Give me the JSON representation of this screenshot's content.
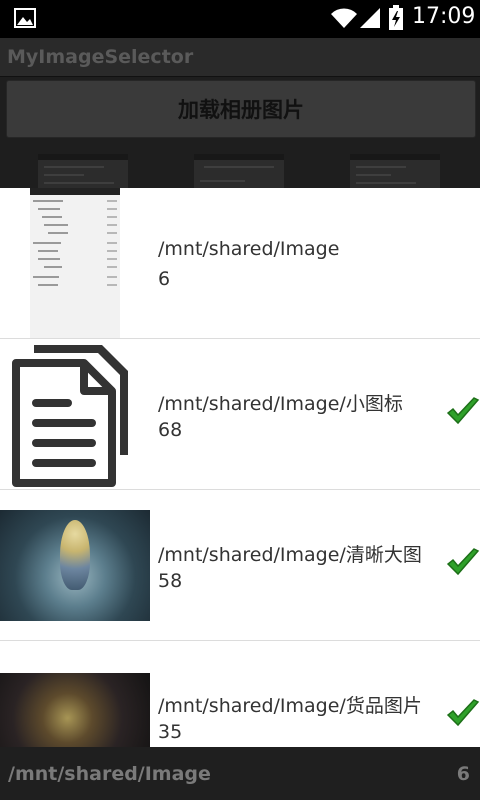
{
  "status_bar": {
    "time": "17:09",
    "icons": [
      "picture-icon",
      "wifi-icon",
      "signal-icon",
      "battery-charging-icon"
    ]
  },
  "app": {
    "title": "MyImageSelector",
    "load_button_label": "加载相册图片"
  },
  "folders": [
    {
      "path": "/mnt/shared/Image",
      "count": "6",
      "thumbnail": "screenshot-thumbnail",
      "selected": false
    },
    {
      "path": "/mnt/shared/Image/小图标",
      "count": "68",
      "thumbnail": "document-icon",
      "selected": true
    },
    {
      "path": "/mnt/shared/Image/清晰大图",
      "count": "58",
      "thumbnail": "anime-art-thumbnail",
      "selected": true
    },
    {
      "path": "/mnt/shared/Image/货品图片",
      "count": "35",
      "thumbnail": "game-art-thumbnail",
      "selected": true
    }
  ],
  "footer": {
    "current_path": "/mnt/shared/Image",
    "current_count": "6"
  },
  "colors": {
    "check_green": "#2fa12a",
    "footer_bg": "#1f1f1f",
    "list_bg": "#ffffff"
  }
}
